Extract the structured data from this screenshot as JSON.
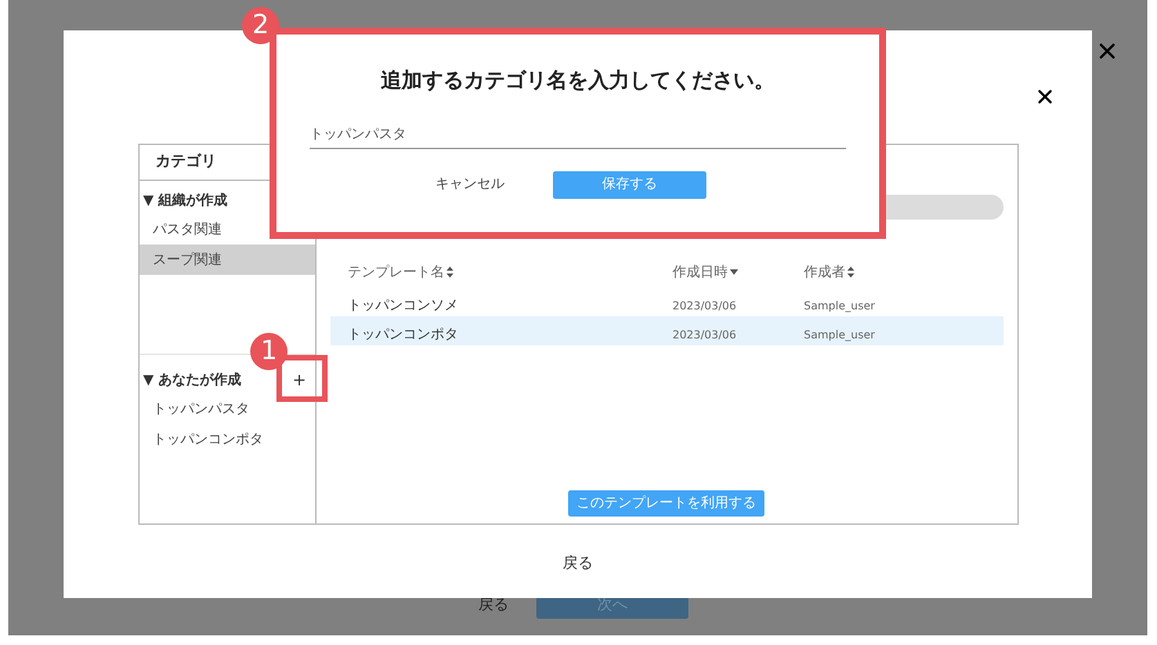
{
  "background_page": {
    "back_button": "戻る",
    "next_button": "次へ"
  },
  "modal": {
    "sidebar": {
      "title": "カテゴリ",
      "sections": [
        {
          "label": "▼ 組織が作成",
          "items": [
            {
              "label": "パスタ関連",
              "selected": false
            },
            {
              "label": "スープ関連",
              "selected": true
            }
          ]
        },
        {
          "label": "▼ あなたが作成",
          "add_button": "+",
          "items": [
            {
              "label": "トッパンパスタ",
              "selected": false
            },
            {
              "label": "トッパンコンポタ",
              "selected": false
            }
          ]
        }
      ]
    },
    "table": {
      "columns": [
        {
          "label": "テンプレート名",
          "kind": "sortable"
        },
        {
          "label": "作成日時",
          "kind": "sorted"
        },
        {
          "label": "作成者",
          "kind": "sortable"
        }
      ],
      "rows": [
        {
          "cells": [
            "トッパンコンソメ",
            "2023/03/06",
            "Sample_user"
          ],
          "selected": false
        },
        {
          "cells": [
            "トッパンコンポタ",
            "2023/03/06",
            "Sample_user"
          ],
          "selected": true
        }
      ]
    },
    "use_button": "このテンプレートを利用する",
    "back_link": "戻る"
  },
  "dialog": {
    "title": "追加するカテゴリ名を入力してください。",
    "input_value": "トッパンパスタ",
    "cancel_button": "キャンセル",
    "save_button": "保存する"
  },
  "annotations": [
    "1",
    "2"
  ]
}
